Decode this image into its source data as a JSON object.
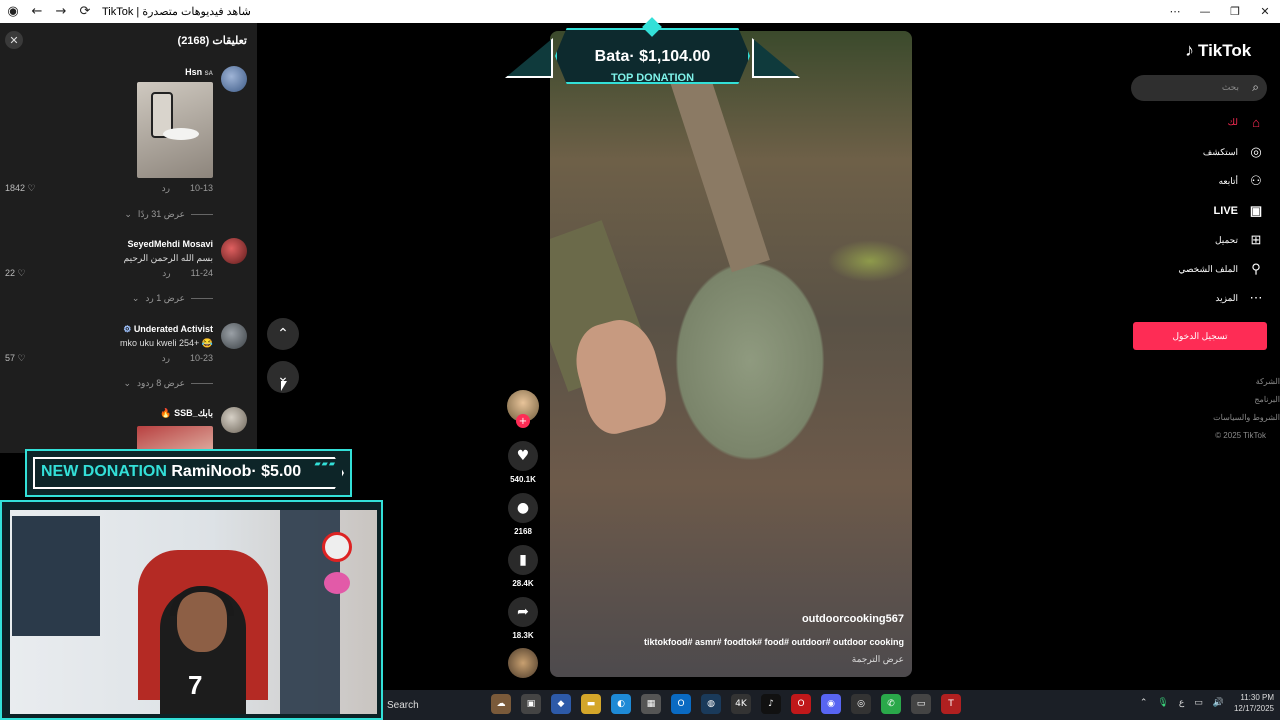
{
  "browser": {
    "title": "TikTok | شاهد فيديوهات متصدرة"
  },
  "comments_panel": {
    "title": "تعليقات (2168)",
    "comments": [
      {
        "name": "Hsn",
        "flag": "SA",
        "date": "10-13",
        "reply": "رد",
        "likes": "1842",
        "replies_label": "عرض 31 ردًا"
      },
      {
        "name": "SeyedMehdi Mosavi",
        "text": "بسم الله الرحمن الرحيم",
        "date": "11-24",
        "reply": "رد",
        "likes": "22",
        "replies_label": "عرض 1 رد"
      },
      {
        "name": "Underated Activist",
        "text": "mko uku kweli 254+",
        "date": "10-23",
        "reply": "رد",
        "likes": "57",
        "replies_label": "عرض 8 ردود"
      },
      {
        "name": "SSB_بابك"
      }
    ]
  },
  "overlays": {
    "top_donation_amount": "Bata· $1,104.00",
    "top_donation_label": "TOP DONATION",
    "new_donation_label": "NEW DONATION",
    "new_donation_text": "RamiNoob· $5.00"
  },
  "video": {
    "username": "outdoorcooking567",
    "hashtags": "tiktokfood# asmr# foodtok# food# outdoor# outdoor cooking",
    "translate": "عرض الترجمة"
  },
  "actions": {
    "likes": "540.1K",
    "comments": "2168",
    "saves": "28.4K",
    "shares": "18.3K"
  },
  "sidebar": {
    "logo": "TikTok",
    "search_placeholder": "بحث",
    "items": [
      {
        "label": "لك",
        "icon": "home-icon",
        "active": true
      },
      {
        "label": "استكشف",
        "icon": "compass-icon"
      },
      {
        "label": "أتابعه",
        "icon": "user-follow-icon"
      },
      {
        "label": "LIVE",
        "icon": "live-icon"
      },
      {
        "label": "تحميل",
        "icon": "upload-icon"
      },
      {
        "label": "الملف الشخصي",
        "icon": "profile-icon"
      },
      {
        "label": "المزيد",
        "icon": "more-icon"
      }
    ],
    "login_label": "تسجيل الدخول",
    "footer": [
      "الشركة",
      "البرنامج",
      "الشروط والسياسات",
      "© 2025 TikTok"
    ]
  },
  "taskbar": {
    "search_label": "Search",
    "time": "11:30 PM",
    "date": "12/17/2025",
    "lang": "ع"
  },
  "colors": {
    "accent": "#fe2c55",
    "overlay_cyan": "#33e0d8"
  }
}
